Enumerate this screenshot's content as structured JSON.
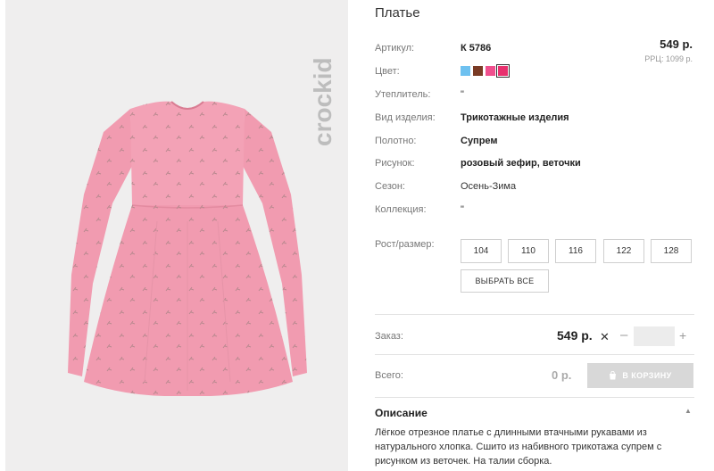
{
  "product": {
    "title": "Платье",
    "price": "549 р.",
    "rrp": "РРЦ: 1099 р.",
    "brand": "crockid"
  },
  "attributes": [
    {
      "label": "Артикул:",
      "value": "К 5786"
    },
    {
      "label": "Цвет:",
      "value": ""
    },
    {
      "label": "Утеплитель:",
      "value": "\""
    },
    {
      "label": "Вид изделия:",
      "value": "Трикотажные изделия"
    },
    {
      "label": "Полотно:",
      "value": "Супрем"
    },
    {
      "label": "Рисунок:",
      "value": "розовый зефир, веточки"
    },
    {
      "label": "Сезон:",
      "value": "Осень-Зима"
    },
    {
      "label": "Коллекция:",
      "value": "\""
    }
  ],
  "colors": [
    {
      "name": "light-blue",
      "hex": "#6ec1f0"
    },
    {
      "name": "brown",
      "hex": "#7a3b25"
    },
    {
      "name": "pink",
      "hex": "#f0508e"
    },
    {
      "name": "magenta",
      "hex": "#e8306e",
      "selected": true
    }
  ],
  "sizes": {
    "label": "Рост/размер:",
    "options": [
      "104",
      "110",
      "116",
      "122",
      "128"
    ],
    "select_all": "ВЫБРАТЬ ВСЕ"
  },
  "order": {
    "label": "Заказ:",
    "price": "549 р.",
    "times": "✕",
    "minus": "–",
    "plus": "+",
    "qty_value": ""
  },
  "total": {
    "label": "Всего:",
    "value": "0 р.",
    "cart_button": "В КОРЗИНУ"
  },
  "description": {
    "title": "Описание",
    "toggle": "▲",
    "text": "Лёгкое отрезное платье с длинными втачными рукавами из натурального хлопка. Сшито из набивного трикотажа супрем с рисунком из веточек. На талии сборка."
  },
  "icons": {
    "cart": "cart-icon",
    "collapse": "chevron-up-icon",
    "brand": "crockid-logo"
  }
}
